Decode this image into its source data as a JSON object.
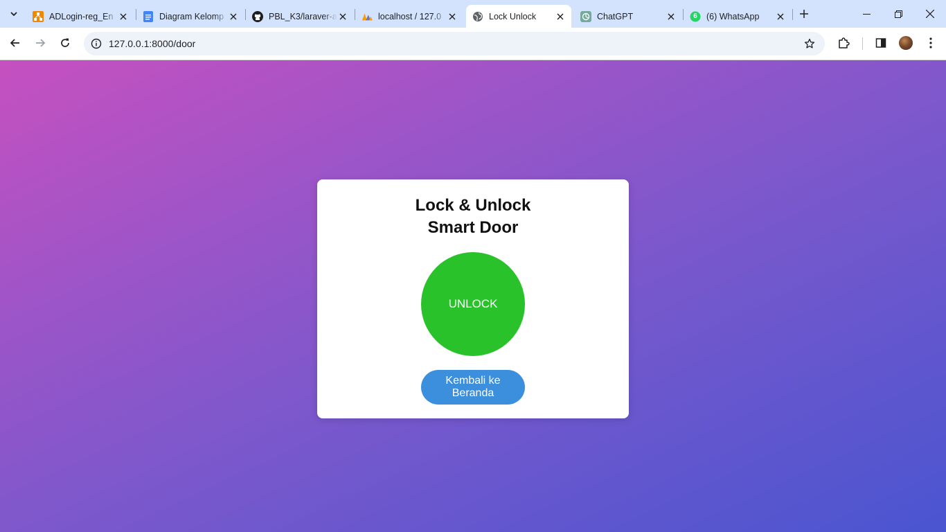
{
  "browser": {
    "tabs": [
      {
        "title": "ADLogin-reg_En",
        "icon": "drawio-icon",
        "active": false
      },
      {
        "title": "Diagram Kelomp",
        "icon": "google-docs-icon",
        "active": false
      },
      {
        "title": "PBL_K3/laraver-a",
        "icon": "github-icon",
        "active": false
      },
      {
        "title": "localhost / 127.0",
        "icon": "phpmyadmin-icon",
        "active": false
      },
      {
        "title": "Lock Unlock",
        "icon": "globe-icon",
        "active": true
      },
      {
        "title": "ChatGPT",
        "icon": "chatgpt-icon",
        "active": false
      },
      {
        "title": "(6) WhatsApp",
        "icon": "whatsapp-icon",
        "active": false
      }
    ],
    "whatsapp_badge": "6",
    "url": "127.0.0.1:8000/door",
    "colors": {
      "tabstrip": "#d3e3fd",
      "omnibox": "#eef2f9"
    }
  },
  "page": {
    "title_line1": "Lock & Unlock",
    "title_line2": "Smart Door",
    "unlock_label": "UNLOCK",
    "home_label": "Kembali ke Beranda",
    "colors": {
      "unlock": "#2ac22a",
      "home": "#3c8fdd",
      "gradient_start": "#c650c0",
      "gradient_end": "#4a55d0"
    }
  }
}
